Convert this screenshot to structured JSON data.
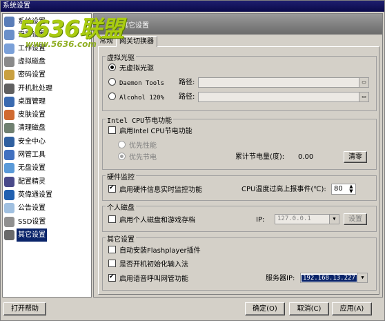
{
  "window": {
    "title": "系统设置"
  },
  "watermark": {
    "brand": "5636联盟",
    "url": "www.5636.com"
  },
  "sidebar": {
    "items": [
      {
        "label": "系统设置",
        "icon": "monitor-icon",
        "color": "#5a7db8"
      },
      {
        "label": "安装设置",
        "icon": "install-icon",
        "color": "#6a8fc9"
      },
      {
        "label": "工作设置",
        "icon": "work-icon",
        "color": "#7aa0d8"
      },
      {
        "label": "虚拟磁盘",
        "icon": "disk-icon",
        "color": "#8a8a8a"
      },
      {
        "label": "密码设置",
        "icon": "key-icon",
        "color": "#c9a040"
      },
      {
        "label": "开机批处理",
        "icon": "batch-icon",
        "color": "#606060"
      },
      {
        "label": "桌面管理",
        "icon": "desktop-icon",
        "color": "#3a6ab0"
      },
      {
        "label": "皮肤设置",
        "icon": "skin-icon",
        "color": "#d06a30"
      },
      {
        "label": "清理磁盘",
        "icon": "clean-icon",
        "color": "#708070"
      },
      {
        "label": "安全中心",
        "icon": "shield-icon",
        "color": "#3060a0"
      },
      {
        "label": "网管工具",
        "icon": "tools-icon",
        "color": "#4070c0"
      },
      {
        "label": "无盘设置",
        "icon": "diskless-icon",
        "color": "#5a9ad8"
      },
      {
        "label": "配置精灵",
        "icon": "wizard-icon",
        "color": "#4a4a8a"
      },
      {
        "label": "英偉通设置",
        "icon": "intel-icon",
        "color": "#2060b0"
      },
      {
        "label": "公告设置",
        "icon": "notice-icon",
        "color": "#a0c0e0"
      },
      {
        "label": "SSD设置",
        "icon": "ssd-icon",
        "color": "#909090"
      },
      {
        "label": "其它设置",
        "icon": "gear-icon",
        "color": "#6a6a6a"
      }
    ],
    "selected": "其它设置"
  },
  "header": {
    "title": "其它设置"
  },
  "tabs": [
    {
      "label": "常规"
    },
    {
      "label": "网关切换器"
    }
  ],
  "virtual_drive": {
    "title": "虚拟光驱",
    "options": [
      {
        "label": "无虚拟光驱",
        "selected": true
      },
      {
        "label": "Daemon Tools",
        "selected": false
      },
      {
        "label": "Alcohol 120%",
        "selected": false
      }
    ],
    "path_label": "路径:",
    "path1": "",
    "path2": ""
  },
  "intel_power": {
    "title": "Intel CPU节电功能",
    "enable_label": "启用Intel CPU节电功能",
    "enabled": false,
    "perf_label": "优先性能",
    "save_label": "优先节电",
    "accum_label": "累计节电量(度):",
    "accum_value": "0.00",
    "clear_label": "清零"
  },
  "hardware": {
    "title": "硬件监控",
    "enable_label": "启用硬件信息实时监控功能",
    "enabled": true,
    "temp_label": "CPU温度过高上报事件(℃):",
    "temp_value": "80"
  },
  "personal_disk": {
    "title": "个人磁盘",
    "enable_label": "启用个人磁盘和游戏存档",
    "enabled": false,
    "ip_label": "IP:",
    "ip_value": "127.0.0.1",
    "settings_label": "设置"
  },
  "other": {
    "title": "其它设置",
    "flash_label": "自动安装Flashplayer插件",
    "flash_enabled": false,
    "ime_label": "是否开机初始化输入法",
    "ime_enabled": false,
    "voice_label": "启用语音呼叫网管功能",
    "voice_enabled": true,
    "server_ip_label": "服务器IP:",
    "server_ip_value": "192.168.13.227"
  },
  "footer": {
    "help_label": "打开帮助",
    "ok_label": "确定(O)",
    "cancel_label": "取消(C)",
    "apply_label": "应用(A)"
  }
}
